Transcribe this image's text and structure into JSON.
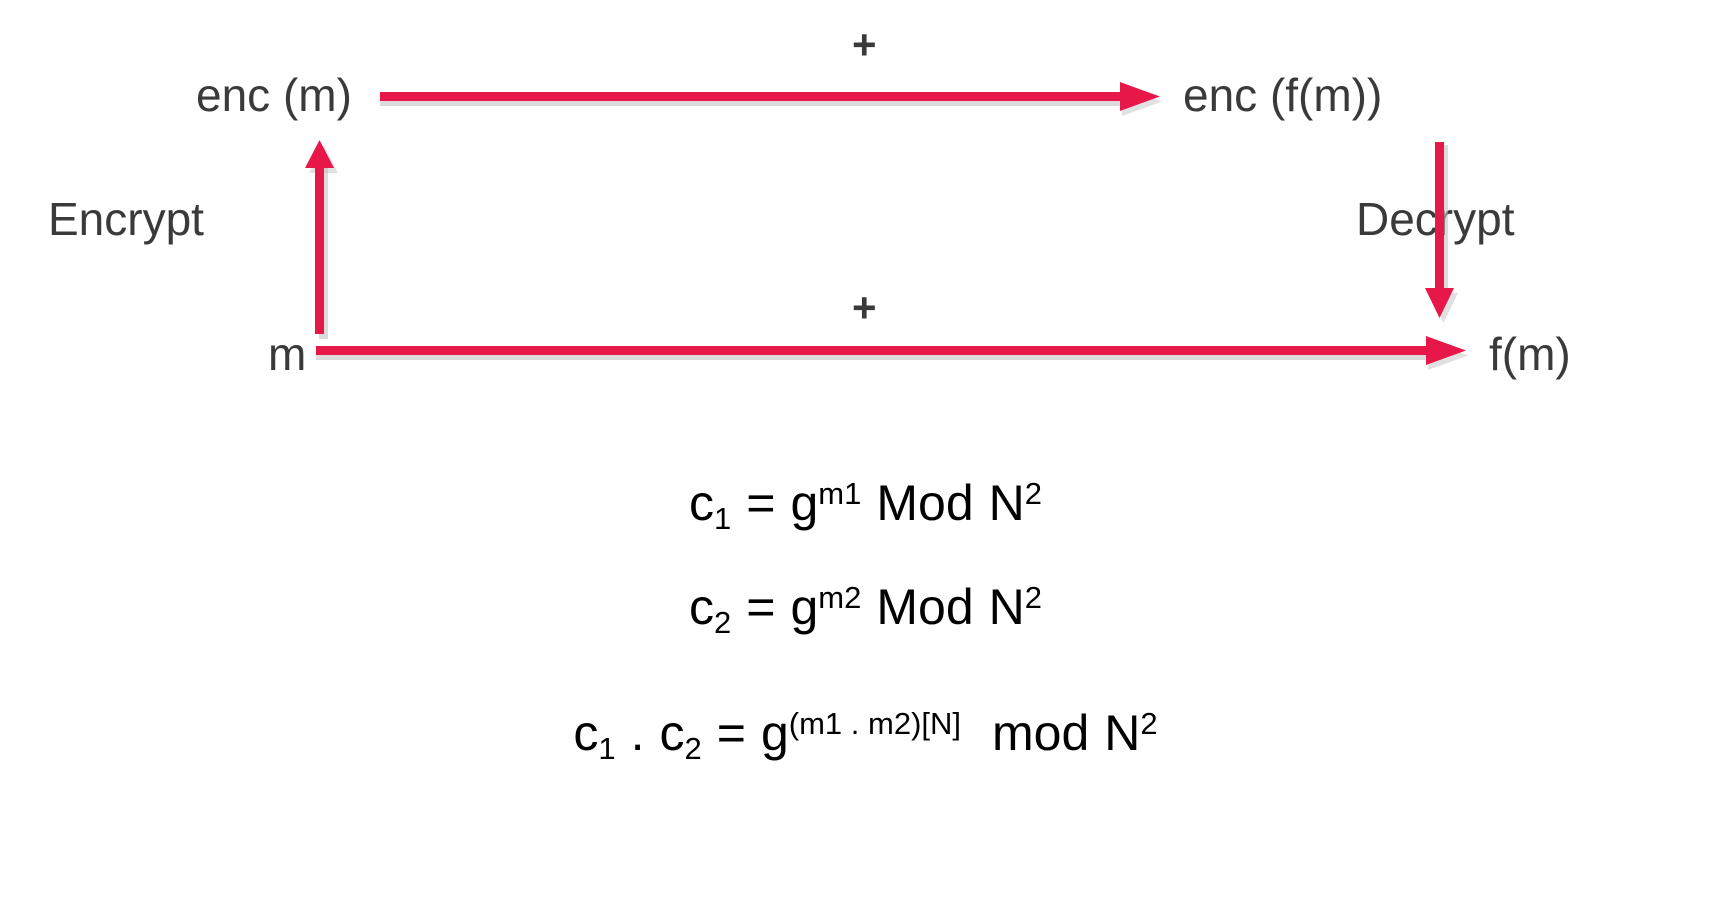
{
  "diagram": {
    "title": "Homomorphic encryption commutative diagram",
    "accent_color": "#E8174A",
    "text_color": "#3a3a3a",
    "nodes": [
      {
        "id": "enc-m",
        "label": "enc (m)"
      },
      {
        "id": "enc-fm",
        "label": "enc (f(m))"
      },
      {
        "id": "m",
        "label": "m"
      },
      {
        "id": "fm",
        "label": "f(m)"
      }
    ],
    "edges": [
      {
        "id": "top",
        "label": "+",
        "direction": "right"
      },
      {
        "id": "bottom",
        "label": "+",
        "direction": "right"
      },
      {
        "id": "left",
        "label": "Encrypt",
        "direction": "up"
      },
      {
        "id": "right",
        "label": "Decrypt",
        "direction": "down"
      }
    ]
  },
  "equations": [
    {
      "id": "eq1",
      "text": "c1 = g^m1 Mod N^2",
      "base": "c",
      "base_sub": "1",
      "eq": "=",
      "g": "g",
      "g_sup": "m1",
      "mod": "Mod",
      "n": "N",
      "n_sup": "2"
    },
    {
      "id": "eq2",
      "text": "c2 = g^m2 Mod N^2",
      "base": "c",
      "base_sub": "2",
      "eq": "=",
      "g": "g",
      "g_sup": "m2",
      "mod": "Mod",
      "n": "N",
      "n_sup": "2"
    },
    {
      "id": "eq3",
      "text": "c1 . c2 = g^(m1 . m2)[N] mod N^2",
      "base": "c",
      "base_sub": "1",
      "dot": ".",
      "base2": "c",
      "base2_sub": "2",
      "eq": "=",
      "g": "g",
      "g_sup": "(m1 . m2)[N]",
      "mod": "mod",
      "n": "N",
      "n_sup": "2"
    }
  ]
}
